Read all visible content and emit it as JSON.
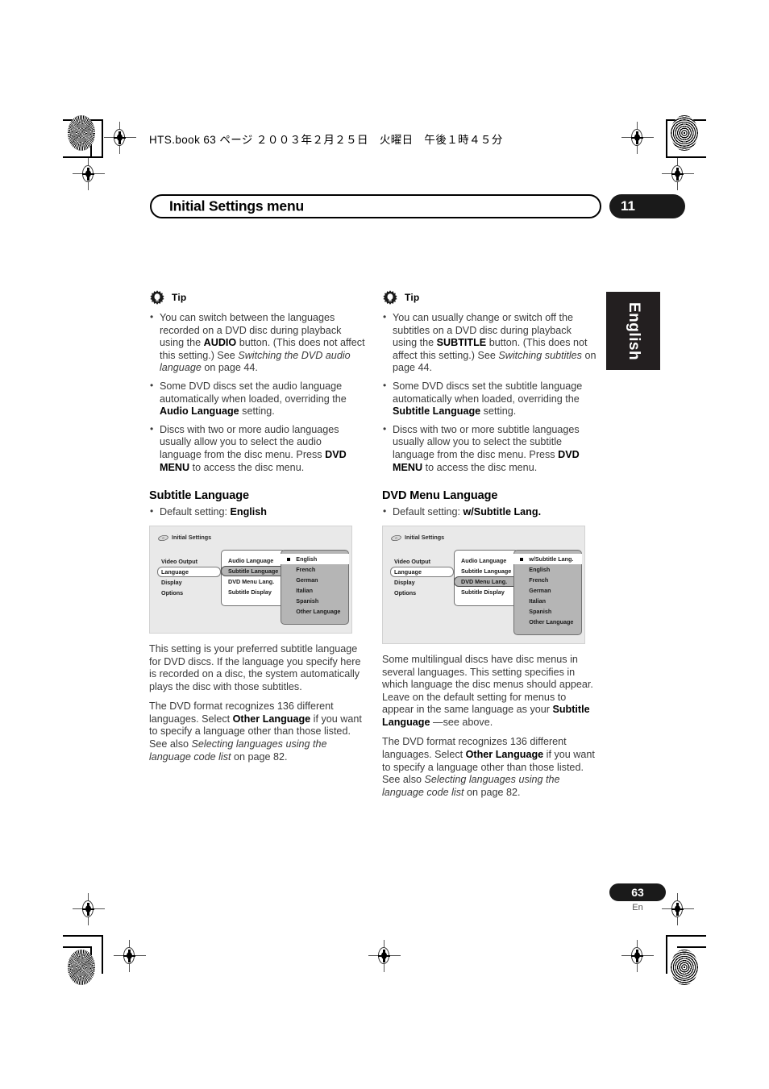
{
  "print_header": {
    "text": "HTS.book  63 ページ  ２００３年２月２５日　火曜日　午後１時４５分"
  },
  "chapter": {
    "title": "Initial Settings menu",
    "number": "11"
  },
  "side_tab": {
    "label": "English"
  },
  "footer": {
    "page_number": "63",
    "language_code": "En"
  },
  "left_column": {
    "tip": {
      "icon": "tip-bulb-icon",
      "label": "Tip",
      "bullets": [
        {
          "parts": [
            {
              "t": "You can switch between the languages recorded on a DVD disc during playback using the ",
              "s": "normal"
            },
            {
              "t": "AUDIO",
              "s": "bold"
            },
            {
              "t": " button. (This does not affect this setting.) See ",
              "s": "normal"
            },
            {
              "t": "Switching the DVD audio language",
              "s": "italic"
            },
            {
              "t": " on page 44.",
              "s": "normal"
            }
          ]
        },
        {
          "parts": [
            {
              "t": "Some DVD discs set the audio language automatically when loaded, overriding the ",
              "s": "normal"
            },
            {
              "t": "Audio Language",
              "s": "bold"
            },
            {
              "t": " setting.",
              "s": "normal"
            }
          ]
        },
        {
          "parts": [
            {
              "t": "Discs with two or more audio languages usually allow you to select the audio language from the disc menu. Press ",
              "s": "normal"
            },
            {
              "t": "DVD MENU",
              "s": "bold"
            },
            {
              "t": " to access the disc menu.",
              "s": "normal"
            }
          ]
        }
      ]
    },
    "section_heading": "Subtitle Language",
    "default_setting": {
      "prefix": "Default setting: ",
      "value": "English"
    },
    "osd": {
      "title": "Initial Settings",
      "column1": [
        {
          "label": "Video Output",
          "selected": false
        },
        {
          "label": "Language",
          "selected": true
        },
        {
          "label": "Display",
          "selected": false
        },
        {
          "label": "Options",
          "selected": false
        }
      ],
      "column2": [
        {
          "label": "Audio Language",
          "selected": false
        },
        {
          "label": "Subtitle Language",
          "selected": true
        },
        {
          "label": "DVD Menu Lang.",
          "selected": false
        },
        {
          "label": "Subtitle Display",
          "selected": false
        }
      ],
      "column3": [
        {
          "label": "English",
          "selected": true
        },
        {
          "label": "French",
          "selected": false
        },
        {
          "label": "German",
          "selected": false
        },
        {
          "label": "Italian",
          "selected": false
        },
        {
          "label": "Spanish",
          "selected": false
        },
        {
          "label": "Other Language",
          "selected": false
        }
      ]
    },
    "paragraphs": [
      {
        "parts": [
          {
            "t": "This setting is your preferred subtitle language for DVD discs. If the language you specify here is recorded on a disc, the system automatically plays the disc with those subtitles.",
            "s": "normal"
          }
        ]
      },
      {
        "parts": [
          {
            "t": "The DVD format recognizes 136 different languages. Select ",
            "s": "normal"
          },
          {
            "t": "Other Language",
            "s": "bold"
          },
          {
            "t": " if you want to specify a language other than those listed. See also ",
            "s": "normal"
          },
          {
            "t": "Selecting languages using the language code list",
            "s": "italic"
          },
          {
            "t": " on page 82.",
            "s": "normal"
          }
        ]
      }
    ]
  },
  "right_column": {
    "tip": {
      "icon": "tip-bulb-icon",
      "label": "Tip",
      "bullets": [
        {
          "parts": [
            {
              "t": "You can usually change or switch off the subtitles on a DVD disc during playback using the ",
              "s": "normal"
            },
            {
              "t": "SUBTITLE",
              "s": "bold"
            },
            {
              "t": " button. (This does not affect this setting.) See ",
              "s": "normal"
            },
            {
              "t": "Switching subtitles",
              "s": "italic"
            },
            {
              "t": " on page 44.",
              "s": "normal"
            }
          ]
        },
        {
          "parts": [
            {
              "t": "Some DVD discs set the subtitle language automatically when loaded, overriding the ",
              "s": "normal"
            },
            {
              "t": "Subtitle Language",
              "s": "bold"
            },
            {
              "t": " setting.",
              "s": "normal"
            }
          ]
        },
        {
          "parts": [
            {
              "t": "Discs with two or more subtitle languages usually allow you to select the subtitle language from the disc menu. Press ",
              "s": "normal"
            },
            {
              "t": "DVD MENU",
              "s": "bold"
            },
            {
              "t": " to access the disc menu.",
              "s": "normal"
            }
          ]
        }
      ]
    },
    "section_heading": "DVD Menu Language",
    "default_setting": {
      "prefix": "Default setting: ",
      "value": "w/Subtitle Lang."
    },
    "osd": {
      "title": "Initial Settings",
      "column1": [
        {
          "label": "Video Output",
          "selected": false
        },
        {
          "label": "Language",
          "selected": true
        },
        {
          "label": "Display",
          "selected": false
        },
        {
          "label": "Options",
          "selected": false
        }
      ],
      "column2": [
        {
          "label": "Audio Language",
          "selected": false
        },
        {
          "label": "Subtitle Language",
          "selected": false
        },
        {
          "label": "DVD Menu Lang.",
          "selected": true
        },
        {
          "label": "Subtitle Display",
          "selected": false
        }
      ],
      "column3": [
        {
          "label": "w/Subtitle Lang.",
          "selected": true
        },
        {
          "label": "English",
          "selected": false
        },
        {
          "label": "French",
          "selected": false
        },
        {
          "label": "German",
          "selected": false
        },
        {
          "label": "Italian",
          "selected": false
        },
        {
          "label": "Spanish",
          "selected": false
        },
        {
          "label": "Other Language",
          "selected": false
        }
      ]
    },
    "paragraphs": [
      {
        "parts": [
          {
            "t": "Some multilingual discs have disc menus in several languages. This setting specifies in which language the disc menus should appear. Leave on the default setting for menus to appear in the same language as your ",
            "s": "normal"
          },
          {
            "t": "Subtitle Language",
            "s": "bold"
          },
          {
            "t": " —see above.",
            "s": "normal"
          }
        ]
      },
      {
        "parts": [
          {
            "t": "The DVD format recognizes 136 different languages. Select ",
            "s": "normal"
          },
          {
            "t": "Other Language",
            "s": "bold"
          },
          {
            "t": " if you want to specify a language other than those listed. See also ",
            "s": "normal"
          },
          {
            "t": "Selecting languages using the language code list",
            "s": "italic"
          },
          {
            "t": " on page 82.",
            "s": "normal"
          }
        ]
      }
    ]
  },
  "colors": {
    "badge_black": "#1a1a1a",
    "osd_background": "#e9e9e9",
    "osd_highlight_gray": "#b5b5b5",
    "body_text": "#3a3a3a"
  }
}
